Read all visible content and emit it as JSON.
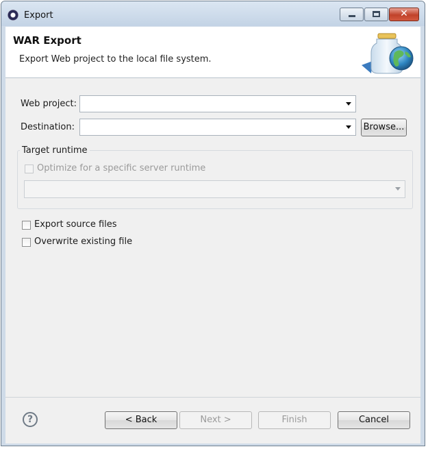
{
  "window": {
    "title": "Export",
    "controls": {
      "minimize": "minimize",
      "maximize": "maximize",
      "close": "close"
    }
  },
  "banner": {
    "title": "WAR Export",
    "description": "Export Web project to the local file system.",
    "icon": "jar-globe-icon"
  },
  "form": {
    "web_project": {
      "label": "Web project:",
      "value": ""
    },
    "destination": {
      "label": "Destination:",
      "value": "",
      "browse_label": "Browse..."
    }
  },
  "target_runtime": {
    "title": "Target runtime",
    "optimize_label": "Optimize for a specific server runtime",
    "optimize_checked": false,
    "runtime_value": ""
  },
  "options": {
    "export_source_label": "Export source files",
    "export_source_checked": false,
    "overwrite_label": "Overwrite existing file",
    "overwrite_checked": false
  },
  "footer": {
    "help_glyph": "?",
    "back_label": "< Back",
    "next_label": "Next >",
    "finish_label": "Finish",
    "cancel_label": "Cancel"
  },
  "colors": {
    "titlebar": "#c3d3e5",
    "content_bg": "#f0f0f0",
    "close_button": "#c1422a"
  }
}
